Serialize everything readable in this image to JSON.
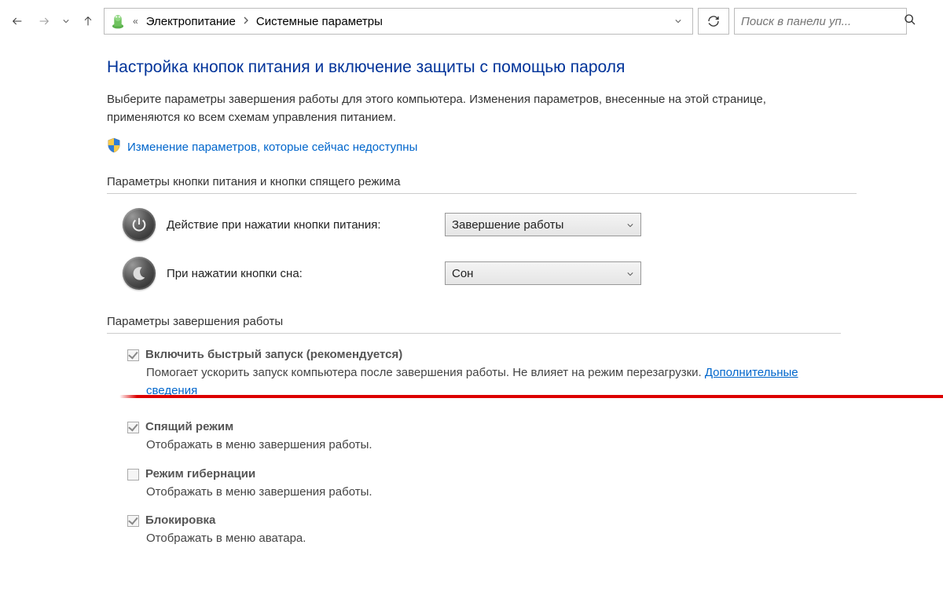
{
  "nav": {
    "breadcrumb_prefix": "«",
    "breadcrumb1": "Электропитание",
    "breadcrumb2": "Системные параметры"
  },
  "search": {
    "placeholder": "Поиск в панели уп..."
  },
  "page": {
    "title": "Настройка кнопок питания и включение защиты с помощью пароля",
    "intro": "Выберите параметры завершения работы для этого компьютера. Изменения параметров, внесенные на этой странице, применяются ко всем схемам управления питанием.",
    "admin_link": "Изменение параметров, которые сейчас недоступны"
  },
  "section1": {
    "heading": "Параметры кнопки питания и кнопки спящего режима",
    "power_button_label": "Действие при нажатии кнопки питания:",
    "power_button_value": "Завершение работы",
    "sleep_button_label": "При нажатии кнопки сна:",
    "sleep_button_value": "Сон"
  },
  "section2": {
    "heading": "Параметры завершения работы",
    "items": [
      {
        "label": "Включить быстрый запуск (рекомендуется)",
        "desc_prefix": "Помогает ускорить запуск компьютера после завершения работы. Не влияет на режим перезагрузки. ",
        "more_link": "Дополнительные сведения",
        "checked": true
      },
      {
        "label": "Спящий режим",
        "desc": "Отображать в меню завершения работы.",
        "checked": true
      },
      {
        "label": "Режим гибернации",
        "desc": "Отображать в меню завершения работы.",
        "checked": false
      },
      {
        "label": "Блокировка",
        "desc": "Отображать в меню аватара.",
        "checked": true
      }
    ]
  }
}
